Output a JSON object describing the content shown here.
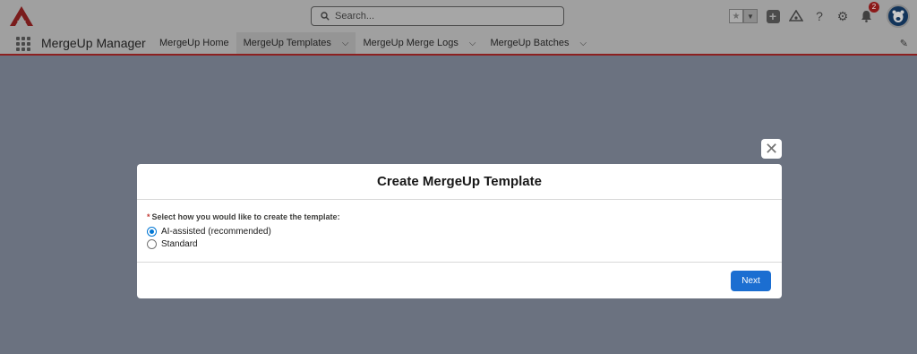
{
  "header": {
    "search_placeholder": "Search...",
    "notification_count": "2",
    "colors": {
      "brand": "#8c1a1a",
      "accent": "#0176d3"
    }
  },
  "nav": {
    "app_name": "MergeUp Manager",
    "tabs": [
      {
        "label": "MergeUp Home",
        "has_menu": false,
        "active": false
      },
      {
        "label": "MergeUp Templates",
        "has_menu": true,
        "active": true
      },
      {
        "label": "MergeUp Merge Logs",
        "has_menu": true,
        "active": false
      },
      {
        "label": "MergeUp Batches",
        "has_menu": true,
        "active": false
      }
    ]
  },
  "modal": {
    "title": "Create MergeUp Template",
    "required_marker": "*",
    "field_label": "Select how you would like to create the template:",
    "options": [
      {
        "label": "AI-assisted (recommended)",
        "selected": true
      },
      {
        "label": "Standard",
        "selected": false
      }
    ],
    "next_label": "Next"
  }
}
